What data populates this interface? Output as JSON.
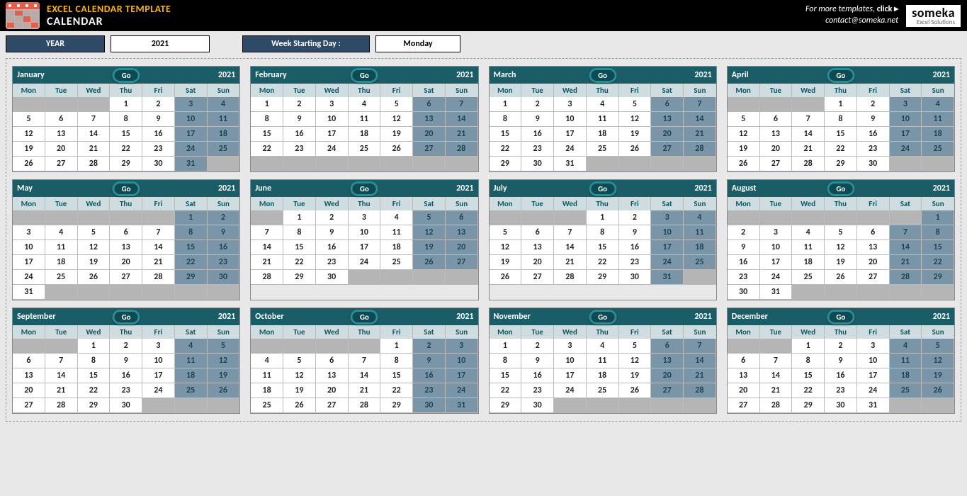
{
  "header": {
    "title1": "EXCEL CALENDAR TEMPLATE",
    "title2": "CALENDAR",
    "more_text": "For more templates, ",
    "more_click": "click ▸",
    "contact": "contact@someka.net",
    "brand_big": "someka",
    "brand_small": "Excel Solutions"
  },
  "controls": {
    "year_label": "YEAR",
    "year_value": "2021",
    "wsd_label": "Week Starting Day :",
    "wsd_value": "Monday",
    "go_label": "Go"
  },
  "day_headers": [
    "Mon",
    "Tue",
    "Wed",
    "Thu",
    "Fri",
    "Sat",
    "Sun"
  ],
  "weekend_cols": [
    5,
    6
  ],
  "months": [
    {
      "name": "January",
      "year": "2021",
      "start": 3,
      "days": 31,
      "rows": 5
    },
    {
      "name": "February",
      "year": "2021",
      "start": 0,
      "days": 28,
      "rows": 5
    },
    {
      "name": "March",
      "year": "2021",
      "start": 0,
      "days": 31,
      "rows": 5
    },
    {
      "name": "April",
      "year": "2021",
      "start": 3,
      "days": 30,
      "rows": 5
    },
    {
      "name": "May",
      "year": "2021",
      "start": 5,
      "days": 31,
      "rows": 6
    },
    {
      "name": "June",
      "year": "2021",
      "start": 1,
      "days": 30,
      "rows": 5
    },
    {
      "name": "July",
      "year": "2021",
      "start": 3,
      "days": 31,
      "rows": 5
    },
    {
      "name": "August",
      "year": "2021",
      "start": 6,
      "days": 31,
      "rows": 6
    },
    {
      "name": "September",
      "year": "2021",
      "start": 2,
      "days": 30,
      "rows": 5
    },
    {
      "name": "October",
      "year": "2021",
      "start": 4,
      "days": 31,
      "rows": 5
    },
    {
      "name": "November",
      "year": "2021",
      "start": 0,
      "days": 30,
      "rows": 5
    },
    {
      "name": "December",
      "year": "2021",
      "start": 2,
      "days": 31,
      "rows": 5
    }
  ]
}
